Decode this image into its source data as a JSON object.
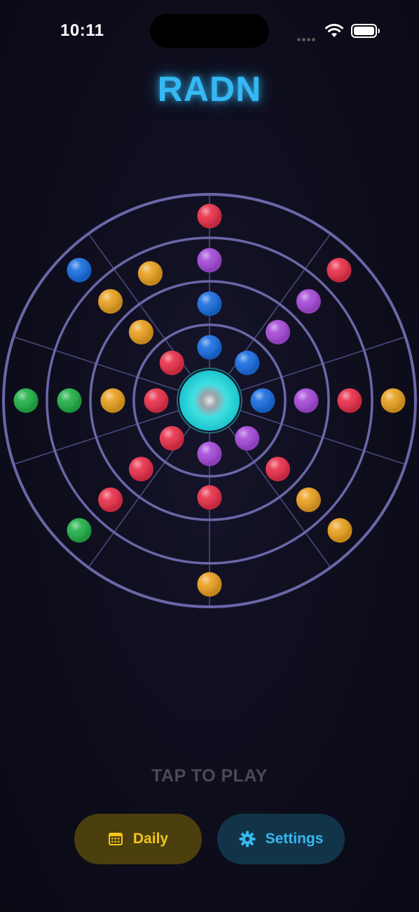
{
  "status_bar": {
    "time": "10:11"
  },
  "app": {
    "title": "RADN"
  },
  "game": {
    "prompt": "TAP TO PLAY",
    "colors": {
      "red": "#e8304a",
      "blue": "#1a6ee0",
      "purple": "#a54ad8",
      "green": "#22b048",
      "yellow": "#e8a020",
      "center": "#26d6da",
      "ring_stroke": "#6a67a8"
    },
    "rings": 4,
    "sectors": 10,
    "balls": {
      "ring1": [
        "blue",
        "blue",
        "blue",
        "purple",
        "purple",
        "red",
        "red",
        "red"
      ],
      "ring2": [
        "blue",
        "purple",
        "purple",
        "red",
        "red",
        "red",
        "yellow",
        "yellow"
      ],
      "ring3": [
        "purple",
        "purple",
        "red",
        "red",
        "yellow",
        "yellow",
        "green",
        "yellow"
      ],
      "ring4": [
        "red",
        "red",
        "yellow",
        "yellow",
        "yellow",
        "green",
        "green",
        "blue"
      ]
    }
  },
  "buttons": {
    "daily": {
      "label": "Daily",
      "icon": "calendar-icon"
    },
    "settings": {
      "label": "Settings",
      "icon": "gear-icon"
    }
  }
}
